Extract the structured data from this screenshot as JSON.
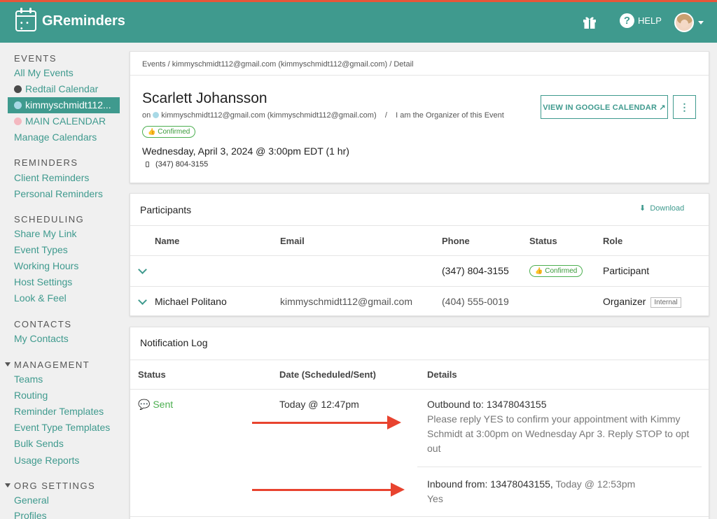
{
  "app": {
    "name": "GReminders",
    "help_label": "HELP"
  },
  "sidebar": {
    "events_heading": "EVENTS",
    "events": [
      {
        "label": "All My Events"
      },
      {
        "label": "Redtail Calendar",
        "dot_color": "#4a4a4a"
      },
      {
        "label": "kimmyschmidt112...",
        "dot_color": "#a8d9e6",
        "active": true
      },
      {
        "label": "MAIN CALENDAR",
        "dot_color": "#f4b8c0"
      },
      {
        "label": "Manage Calendars"
      }
    ],
    "reminders_heading": "REMINDERS",
    "reminders": [
      "Client Reminders",
      "Personal Reminders"
    ],
    "scheduling_heading": "SCHEDULING",
    "scheduling": [
      "Share My Link",
      "Event Types",
      "Working Hours",
      "Host Settings",
      "Look & Feel"
    ],
    "contacts_heading": "CONTACTS",
    "contacts": [
      "My Contacts"
    ],
    "management_heading": "MANAGEMENT",
    "management": [
      "Teams",
      "Routing",
      "Reminder Templates",
      "Event Type Templates",
      "Bulk Sends",
      "Usage Reports"
    ],
    "org_heading": "ORG SETTINGS",
    "org": [
      "General",
      "Profiles"
    ]
  },
  "event": {
    "breadcrumb": "Events / kimmyschmidt112@gmail.com (kimmyschmidt112@gmail.com) / Detail",
    "title": "Scarlett Johansson",
    "on_label": "on",
    "calendar": "kimmyschmidt112@gmail.com (kimmyschmidt112@gmail.com)",
    "separator": "/",
    "organizer_note": "I am the Organizer of this Event",
    "status": "Confirmed",
    "datetime": "Wednesday, April 3, 2024 @ 3:00pm EDT (1 hr)",
    "phone": "(347) 804-3155",
    "gcal_button": "VIEW IN GOOGLE CALENDAR",
    "more_button": "⋮"
  },
  "participants": {
    "title": "Participants",
    "download_label": "Download",
    "columns": [
      "Name",
      "Email",
      "Phone",
      "Status",
      "Role"
    ],
    "rows": [
      {
        "name": "",
        "email": "",
        "phone": "(347) 804-3155",
        "status": "Confirmed",
        "role": "Participant",
        "tag": ""
      },
      {
        "name": "Michael Politano",
        "email": "kimmyschmidt112@gmail.com",
        "phone": "(404) 555-0019",
        "status": "",
        "role": "Organizer",
        "tag": "Internal"
      }
    ]
  },
  "log": {
    "title": "Notification Log",
    "columns": [
      "Status",
      "Date (Scheduled/Sent)",
      "Details"
    ],
    "entry": {
      "status": "Sent",
      "date": "Today @ 12:47pm",
      "outbound_label": "Outbound to: 13478043155",
      "outbound_message": "Please reply YES to confirm your appointment with Kimmy Schmidt at 3:00pm on Wednesday Apr 3. Reply STOP to opt out",
      "inbound_label": "Inbound from: 13478043155,",
      "inbound_time": "Today @ 12:53pm",
      "inbound_message": "Yes"
    }
  },
  "colors": {
    "primary": "#3f9a8e",
    "accent_bar": "#e8553a",
    "confirmed": "#4caf50",
    "arrow": "#e8432f"
  },
  "icons": [
    "calendar-logo-icon",
    "gift-icon",
    "help-icon",
    "chevron-down-icon",
    "external-link-icon",
    "kebab-icon",
    "download-icon",
    "phone-icon",
    "thumbs-up-icon",
    "chat-bubble-icon"
  ]
}
